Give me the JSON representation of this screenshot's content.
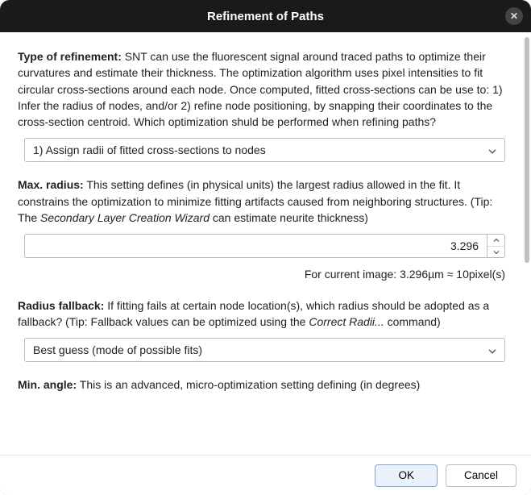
{
  "titlebar": {
    "title": "Refinement of Paths"
  },
  "sections": {
    "type_of_refinement": {
      "label": "Type of refinement:",
      "text_a": " SNT can use the fluorescent signal around traced paths to optimize their curvatures and estimate their thickness. The optimization algorithm uses pixel intensities to fit circular cross-sections around each node. Once computed, fitted cross-sections can be use to: 1) Infer the radius of nodes, and/or 2) refine node positioning, by snapping their coordinates to the cross-section centroid. Which optimization shuld be performed when refining paths?",
      "selected": "1) Assign radii of fitted cross-sections to nodes"
    },
    "max_radius": {
      "label": "Max. radius:",
      "text_a": " This setting defines (in physical units) the largest radius allowed in the fit. It constrains the optimization to minimize fitting artifacts caused from neighboring structures. (Tip: The ",
      "italic_a": "Secondary Layer Creation Wizard",
      "text_b": " can estimate neurite thickness)",
      "value": "3.296",
      "hint": "For current image: 3.296µm ≈ 10pixel(s)"
    },
    "radius_fallback": {
      "label": "Radius fallback:",
      "text_a": " If fitting fails at certain node location(s), which radius should be adopted as a fallback? (Tip: Fallback values can be optimized using the ",
      "italic_a": "Correct Radii...",
      "text_b": " command)",
      "selected": "Best guess (mode of possible fits)"
    },
    "min_angle": {
      "label": "Min. angle:",
      "text_a": " This is an advanced, micro-optimization setting defining (in degrees)"
    }
  },
  "buttons": {
    "ok": "OK",
    "cancel": "Cancel"
  }
}
